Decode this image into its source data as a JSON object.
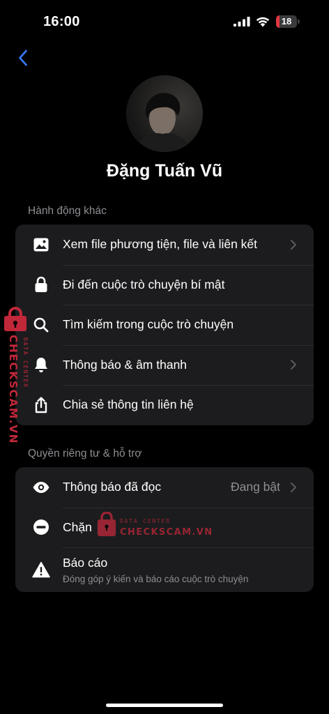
{
  "status_bar": {
    "time": "16:00",
    "battery": "18",
    "battery_level": 0.18,
    "battery_color": "#e2363f"
  },
  "nav": {
    "back_icon": "chevron-left-icon",
    "accent": "#3478f6"
  },
  "profile": {
    "name": "Đặng Tuấn Vũ"
  },
  "sections": [
    {
      "title": "Hành động khác",
      "items": [
        {
          "icon": "photo-icon",
          "label": "Xem file phương tiện, file và liên kết",
          "chevron": true
        },
        {
          "icon": "lock-icon",
          "label": "Đi đến cuộc trò chuyện bí mật",
          "chevron": false
        },
        {
          "icon": "search-icon",
          "label": "Tìm kiếm trong cuộc trò chuyện",
          "chevron": false
        },
        {
          "icon": "bell-icon",
          "label": "Thông báo & âm thanh",
          "chevron": true
        },
        {
          "icon": "share-icon",
          "label": "Chia sẻ thông tin liên hệ",
          "chevron": false
        }
      ]
    },
    {
      "title": "Quyền riêng tư & hỗ trợ",
      "items": [
        {
          "icon": "eye-icon",
          "label": "Thông báo đã đọc",
          "value": "Đang bật",
          "chevron": true
        },
        {
          "icon": "block-icon",
          "label": "Chặn",
          "chevron": false
        },
        {
          "icon": "warning-icon",
          "label": "Báo cáo",
          "sublabel": "Đóng góp ý kiến và báo cáo cuộc trò chuyện",
          "chevron": false
        }
      ]
    }
  ],
  "watermark": {
    "small": "DATA CENTER",
    "big": "CHECKSCAM.VN",
    "color": "#c0283a"
  }
}
